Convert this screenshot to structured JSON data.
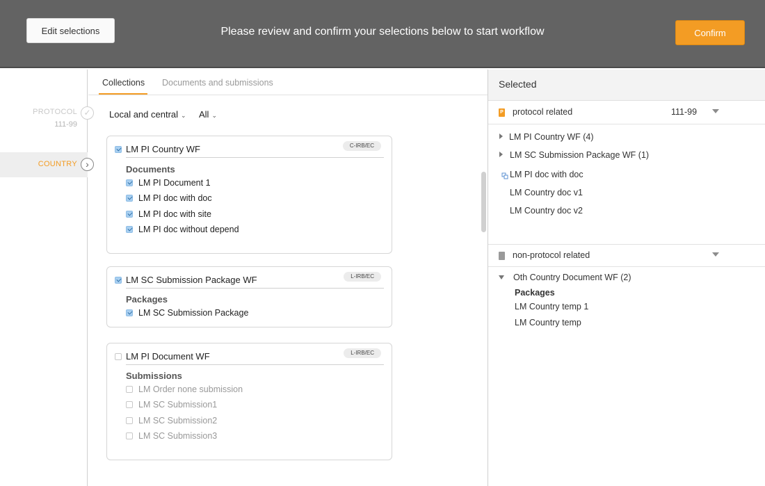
{
  "header": {
    "edit_label": "Edit selections",
    "title": "Please review and confirm your selections below to start workflow",
    "confirm_label": "Confirm",
    "accent_color": "#f39c24"
  },
  "steps": {
    "protocol": {
      "label": "PROTOCOL",
      "sub": "111-99",
      "icon": "check-icon"
    },
    "country": {
      "label": "COUNTRY",
      "icon": "chevron-right-icon"
    }
  },
  "tabs": {
    "collections": "Collections",
    "documents": "Documents and submissions"
  },
  "filters": {
    "scope": "Local and central",
    "status": "All"
  },
  "cards": [
    {
      "title": "LM PI Country WF",
      "tag": "C-IRB/EC",
      "checked": true,
      "section": "Documents",
      "items": [
        "LM PI Document 1",
        "LM PI doc with doc",
        "LM PI doc with site",
        "LM PI doc without depend"
      ]
    },
    {
      "title": "LM SC Submission Package WF",
      "tag": "L-IRB/EC",
      "checked": true,
      "section": "Packages",
      "items": [
        "LM SC Submission Package"
      ]
    },
    {
      "title": "LM PI Document WF",
      "tag": "L-IRB/EC",
      "checked": false,
      "section": "Submissions",
      "items": [
        "LM Order none submission",
        "LM SC Submission1",
        "LM SC Submission2",
        "LM SC Submission3"
      ]
    }
  ],
  "selected": {
    "heading": "Selected",
    "groups": [
      {
        "name": "protocol related",
        "value": "111-99",
        "icon": "protocol-badge-icon",
        "icon_letter": "P",
        "items": [
          {
            "label": "LM PI Country WF (4)",
            "type": "collapsed"
          },
          {
            "label": "LM SC Submission Package WF (1)",
            "type": "collapsed"
          },
          {
            "label": "LM PI doc with doc",
            "type": "linked"
          },
          {
            "label": "LM Country doc v1",
            "type": "plain"
          },
          {
            "label": "LM Country doc v2",
            "type": "plain"
          }
        ]
      },
      {
        "name": "non-protocol related",
        "icon": "document-icon",
        "items": [
          {
            "label": "Oth Country Document WF (2)",
            "type": "expanded"
          },
          {
            "label": "Packages",
            "type": "heading"
          },
          {
            "label": "LM Country temp 1",
            "type": "plain"
          },
          {
            "label": "LM Country temp",
            "type": "plain"
          }
        ]
      }
    ]
  }
}
